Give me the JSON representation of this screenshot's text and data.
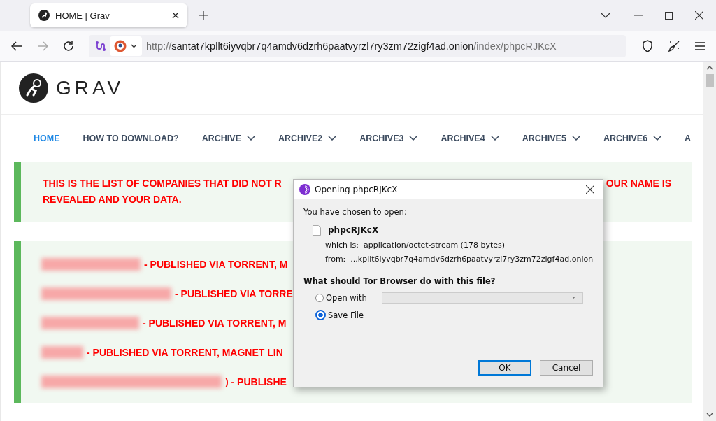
{
  "browser": {
    "tabs": [
      {
        "title": "HOME | Grav",
        "selected": true
      }
    ],
    "nav_buttons": [
      {
        "kind": "back",
        "disabled": false
      },
      {
        "kind": "forward",
        "disabled": true
      },
      {
        "kind": "reload",
        "disabled": false
      }
    ],
    "url": {
      "scheme": "http://",
      "host": "santat7kpllt6iyvqbr7q4amdv6dzrh6paatvyrzl7ry3zm72zigf4ad.onion",
      "path": "/index/phpcRJKcX"
    }
  },
  "site": {
    "logo_text": "GRAV",
    "nav": [
      {
        "label": "HOME",
        "selected": true,
        "dropdown": false
      },
      {
        "label": "HOW TO DOWNLOAD?",
        "selected": false,
        "dropdown": false
      },
      {
        "label": "ARCHIVE",
        "selected": false,
        "dropdown": true
      },
      {
        "label": "ARCHIVE2",
        "selected": false,
        "dropdown": true
      },
      {
        "label": "ARCHIVE3",
        "selected": false,
        "dropdown": true
      },
      {
        "label": "ARCHIVE4",
        "selected": false,
        "dropdown": true
      },
      {
        "label": "ARCHIVE5",
        "selected": false,
        "dropdown": true
      },
      {
        "label": "ARCHIVE6",
        "selected": false,
        "dropdown": true
      },
      {
        "label": "A",
        "selected": false,
        "dropdown": false
      }
    ],
    "notice": [
      {
        "left": "THIS IS THE LIST OF COMPANIES THAT DID NOT R",
        "right": "OUR NAME IS"
      },
      {
        "left": "REVEALED AND YOUR DATA."
      }
    ],
    "entries": [
      {
        "text": "- PUBLISHED VIA TORRENT, M"
      },
      {
        "text": "- PUBLISHED VIA TORRE"
      },
      {
        "text": "- PUBLISHED VIA TORRENT, M"
      },
      {
        "text": "- PUBLISHED VIA TORRENT, MAGNET LIN"
      },
      {
        "text": ") - PUBLISHE"
      }
    ]
  },
  "dialog": {
    "title": "Opening phpcRJKcX",
    "intro": "You have chosen to open:",
    "file_name": "phpcRJKcX",
    "type_label": "which is:",
    "type_value": "application/octet-stream (178 bytes)",
    "from_label": "from:",
    "from_value": "...kpllt6iyvqbr7q4amdv6dzrh6paatvyrzl7ry3zm72zigf4ad.onion",
    "question": "What should Tor Browser do with this file?",
    "options": [
      {
        "kind": "open_with",
        "label": "Open with",
        "selected": false
      },
      {
        "kind": "save",
        "label": "Save File",
        "selected": true
      }
    ],
    "buttons": [
      {
        "label": "OK",
        "default": true
      },
      {
        "label": "Cancel",
        "default": false
      }
    ]
  }
}
